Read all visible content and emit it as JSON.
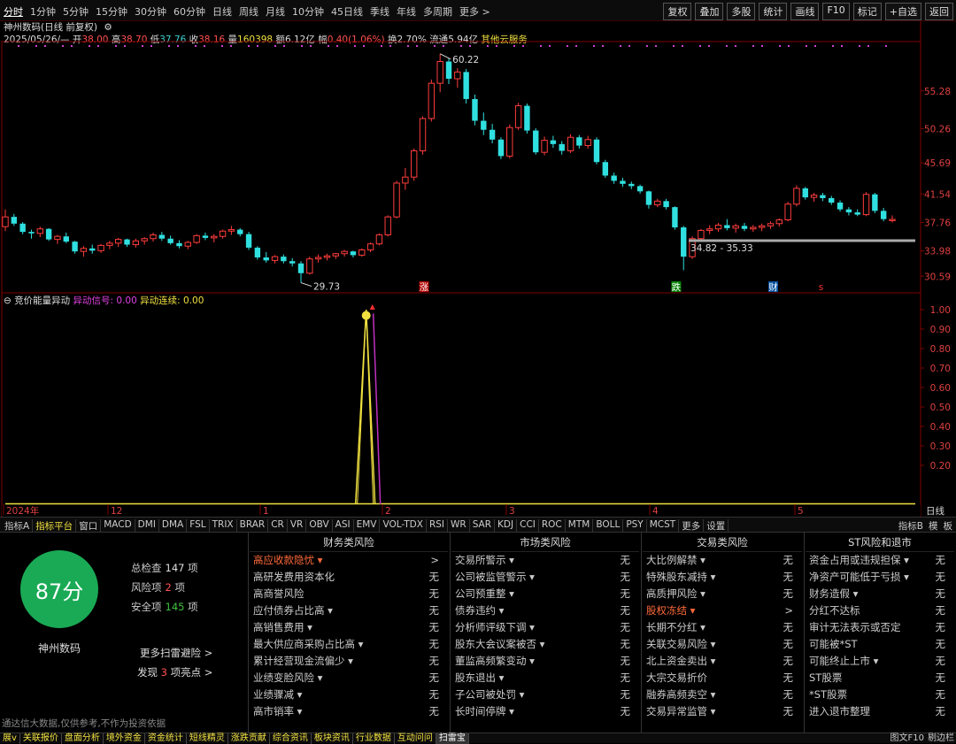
{
  "toolbar": {
    "periods": [
      "分时",
      "1分钟",
      "5分钟",
      "15分钟",
      "30分钟",
      "60分钟",
      "日线",
      "周线",
      "月线",
      "10分钟",
      "45日线",
      "季线",
      "年线",
      "多周期",
      "更多 >"
    ],
    "selected_index": 0,
    "right_buttons": [
      "复权",
      "叠加",
      "多股",
      "统计",
      "画线",
      "F10",
      "标记",
      "+自选",
      "返回"
    ]
  },
  "chart_header": {
    "title": "神州数码(日线 前复权)",
    "date": "2025/05/26/—",
    "open_label": "开",
    "open": "38.00",
    "high_label": "高",
    "high": "38.70",
    "low_label": "低",
    "low": "37.76",
    "close_label": "收",
    "close": "38.16",
    "vol_label": "量",
    "vol": "160398",
    "amount_label": "额",
    "amount": "6.12亿",
    "pct_label": "幅",
    "pct": "0.40(1.06%)",
    "turnover_label": "换",
    "turnover": "2.70%",
    "float_label": "流通",
    "float": "5.94亿",
    "concept": "其他云服务"
  },
  "price_axis": [
    "55.28",
    "50.26",
    "45.69",
    "41.54",
    "37.76",
    "33.98",
    "30.59"
  ],
  "price_annotations": {
    "high_mark": "60.22",
    "low_mark": "29.73",
    "range": "34.82 - 35.33"
  },
  "event_markers": {
    "zhang": "涨",
    "die": "跌",
    "cai": "财",
    "s": "s"
  },
  "indicator": {
    "name": "竞价能量异动",
    "sig1_label": "异动信号",
    "sig1": "0.00",
    "sig2_label": "异动连续",
    "sig2": "0.00",
    "axis": [
      "1.00",
      "0.90",
      "0.80",
      "0.70",
      "0.60",
      "0.50",
      "0.40",
      "0.30",
      "0.20"
    ]
  },
  "date_axis": {
    "labels": [
      "2024年",
      "12",
      "1",
      "2",
      "3",
      "4",
      "5"
    ],
    "right_label": "日线"
  },
  "tabs": {
    "items": [
      "指标A",
      "指标平台",
      "窗口",
      "MACD",
      "DMI",
      "DMA",
      "FSL",
      "TRIX",
      "BRAR",
      "CR",
      "VR",
      "OBV",
      "ASI",
      "EMV",
      "VOL-TDX",
      "RSI",
      "WR",
      "SAR",
      "KDJ",
      "CCI",
      "ROC",
      "MTM",
      "BOLL",
      "PSY",
      "MCST",
      "更多",
      "设置"
    ],
    "right": [
      "指标B",
      "模",
      "板"
    ]
  },
  "panel": {
    "score": "87分",
    "stock_name": "神州数码",
    "total_label": "总检查",
    "total": "147",
    "total_unit": "项",
    "risk_label": "风险项",
    "risk": "2",
    "risk_unit": "项",
    "safe_label": "安全项",
    "safe": "145",
    "safe_unit": "项",
    "more_link": "更多扫雷避险 >",
    "found_pre": "发现",
    "found": "3",
    "found_post": "项亮点 >",
    "columns": [
      {
        "title": "财务类风险",
        "rows": [
          {
            "label": "高应收款隐忧 ▾",
            "value": ">",
            "hl": true
          },
          {
            "label": "高研发费用资本化",
            "value": "无"
          },
          {
            "label": "高商誉风险",
            "value": "无"
          },
          {
            "label": "应付债券占比高 ▾",
            "value": "无"
          },
          {
            "label": "高销售费用 ▾",
            "value": "无"
          },
          {
            "label": "最大供应商采购占比高 ▾",
            "value": "无"
          },
          {
            "label": "累计经营现金流偏少 ▾",
            "value": "无"
          },
          {
            "label": "业绩变脸风险 ▾",
            "value": "无"
          },
          {
            "label": "业绩骤减 ▾",
            "value": "无"
          },
          {
            "label": "高市销率 ▾",
            "value": "无"
          }
        ]
      },
      {
        "title": "市场类风险",
        "rows": [
          {
            "label": "交易所警示 ▾",
            "value": "无"
          },
          {
            "label": "公司被监管警示 ▾",
            "value": "无"
          },
          {
            "label": "公司预重整 ▾",
            "value": "无"
          },
          {
            "label": "债券违约 ▾",
            "value": "无"
          },
          {
            "label": "分析师评级下调 ▾",
            "value": "无"
          },
          {
            "label": "股东大会议案被否 ▾",
            "value": "无"
          },
          {
            "label": "董监高频繁变动 ▾",
            "value": "无"
          },
          {
            "label": "股东退出 ▾",
            "value": "无"
          },
          {
            "label": "子公司被处罚 ▾",
            "value": "无"
          },
          {
            "label": "长时间停牌 ▾",
            "value": "无"
          }
        ]
      },
      {
        "title": "交易类风险",
        "rows": [
          {
            "label": "大比例解禁 ▾",
            "value": "无"
          },
          {
            "label": "特殊股东减持 ▾",
            "value": "无"
          },
          {
            "label": "高质押风险 ▾",
            "value": "无"
          },
          {
            "label": "股权冻结 ▾",
            "value": ">",
            "hl": true
          },
          {
            "label": "长期不分红 ▾",
            "value": "无"
          },
          {
            "label": "关联交易风险 ▾",
            "value": "无"
          },
          {
            "label": "北上资金卖出 ▾",
            "value": "无"
          },
          {
            "label": "大宗交易折价",
            "value": "无"
          },
          {
            "label": "融券高频卖空 ▾",
            "value": "无"
          },
          {
            "label": "交易异常监管 ▾",
            "value": "无"
          }
        ]
      },
      {
        "title": "ST风险和退市",
        "rows": [
          {
            "label": "资金占用或违规担保 ▾",
            "value": "无"
          },
          {
            "label": "净资产可能低于亏损 ▾",
            "value": "无"
          },
          {
            "label": "财务造假 ▾",
            "value": "无"
          },
          {
            "label": "分红不达标",
            "value": "无"
          },
          {
            "label": "审计无法表示或否定",
            "value": "无"
          },
          {
            "label": "可能被*ST",
            "value": "无"
          },
          {
            "label": "可能终止上市 ▾",
            "value": "无"
          },
          {
            "label": "ST股票",
            "value": "无"
          },
          {
            "label": "*ST股票",
            "value": "无"
          },
          {
            "label": "进入退市整理",
            "value": "无"
          }
        ]
      }
    ]
  },
  "disclaimer": "通达信大数据,仅供参考,不作为投资依据",
  "bottom_tabs": {
    "items": [
      "展v",
      "关联报价",
      "盘面分析",
      "境外资金",
      "资金统计",
      "短线精灵",
      "涨跌贡献",
      "综合资讯",
      "板块资讯",
      "行业数据",
      "互动问问",
      "扫雷宝"
    ],
    "active_index": 11,
    "right": [
      "图文F10",
      "剔边栏"
    ]
  },
  "chart_data": {
    "type": "candlestick",
    "title": "神州数码(日线 前复权)",
    "y_ticks": [
      55.28,
      50.26,
      45.69,
      41.54,
      37.76,
      33.98,
      30.59
    ],
    "ohlc": [
      [
        37.2,
        39.5,
        36.6,
        38.5
      ],
      [
        38.5,
        38.9,
        37.3,
        37.6
      ],
      [
        37.6,
        37.8,
        36.2,
        36.5
      ],
      [
        36.5,
        36.8,
        35.6,
        36.3
      ],
      [
        36.3,
        37.2,
        35.8,
        36.9
      ],
      [
        36.9,
        37.0,
        35.3,
        35.5
      ],
      [
        35.5,
        36.1,
        34.9,
        35.9
      ],
      [
        35.9,
        36.4,
        35.0,
        35.2
      ],
      [
        35.2,
        35.3,
        33.6,
        33.9
      ],
      [
        33.9,
        34.6,
        33.2,
        34.3
      ],
      [
        34.3,
        34.8,
        33.6,
        34.0
      ],
      [
        34.0,
        34.9,
        33.7,
        34.7
      ],
      [
        34.7,
        35.3,
        34.2,
        35.0
      ],
      [
        35.0,
        35.7,
        34.5,
        35.5
      ],
      [
        35.5,
        35.6,
        34.5,
        34.8
      ],
      [
        34.8,
        35.6,
        34.4,
        35.3
      ],
      [
        35.3,
        35.8,
        34.8,
        35.6
      ],
      [
        35.6,
        36.4,
        35.2,
        36.1
      ],
      [
        36.1,
        36.5,
        35.3,
        35.6
      ],
      [
        35.6,
        36.0,
        34.8,
        35.0
      ],
      [
        35.0,
        35.4,
        34.3,
        34.6
      ],
      [
        34.6,
        35.3,
        34.2,
        35.1
      ],
      [
        35.1,
        36.2,
        34.9,
        36.0
      ],
      [
        36.0,
        36.4,
        35.4,
        35.7
      ],
      [
        35.7,
        36.2,
        35.1,
        35.9
      ],
      [
        35.9,
        36.8,
        35.6,
        36.6
      ],
      [
        36.6,
        37.3,
        36.1,
        36.8
      ],
      [
        36.8,
        37.0,
        35.9,
        36.2
      ],
      [
        36.2,
        36.5,
        34.1,
        34.4
      ],
      [
        34.4,
        34.6,
        32.8,
        33.1
      ],
      [
        33.1,
        33.8,
        32.4,
        32.7
      ],
      [
        32.7,
        33.4,
        32.3,
        33.2
      ],
      [
        33.2,
        33.5,
        32.3,
        32.6
      ],
      [
        32.6,
        33.0,
        31.9,
        32.3
      ],
      [
        32.3,
        32.6,
        29.73,
        31.0
      ],
      [
        31.0,
        33.2,
        30.8,
        32.9
      ],
      [
        32.9,
        33.5,
        32.4,
        33.1
      ],
      [
        33.1,
        33.6,
        32.7,
        33.3
      ],
      [
        33.3,
        33.7,
        32.9,
        33.6
      ],
      [
        33.6,
        34.1,
        33.2,
        33.9
      ],
      [
        33.9,
        34.0,
        33.1,
        33.4
      ],
      [
        33.4,
        34.3,
        33.2,
        34.1
      ],
      [
        34.1,
        35.1,
        33.8,
        34.9
      ],
      [
        34.9,
        36.3,
        34.7,
        36.1
      ],
      [
        36.1,
        38.7,
        35.9,
        38.5
      ],
      [
        38.5,
        43.3,
        38.3,
        43.0
      ],
      [
        43.0,
        45.0,
        42.1,
        43.8
      ],
      [
        43.8,
        47.6,
        43.3,
        47.3
      ],
      [
        47.3,
        51.9,
        46.8,
        51.6
      ],
      [
        51.6,
        56.8,
        51.2,
        56.3
      ],
      [
        56.3,
        60.22,
        55.1,
        59.2
      ],
      [
        59.2,
        59.6,
        56.2,
        56.9
      ],
      [
        56.9,
        58.3,
        55.7,
        57.8
      ],
      [
        57.8,
        58.2,
        53.6,
        54.2
      ],
      [
        54.2,
        54.8,
        50.7,
        51.3
      ],
      [
        51.3,
        52.4,
        49.4,
        50.1
      ],
      [
        50.1,
        50.9,
        48.3,
        48.8
      ],
      [
        48.8,
        49.1,
        46.2,
        46.6
      ],
      [
        46.6,
        50.8,
        46.3,
        50.4
      ],
      [
        50.4,
        53.7,
        50.1,
        53.3
      ],
      [
        53.3,
        53.6,
        49.6,
        50.0
      ],
      [
        50.0,
        50.3,
        46.8,
        47.1
      ],
      [
        47.1,
        49.2,
        46.7,
        48.7
      ],
      [
        48.7,
        49.3,
        47.7,
        48.2
      ],
      [
        48.2,
        48.6,
        46.8,
        47.3
      ],
      [
        47.3,
        49.5,
        47.0,
        49.1
      ],
      [
        49.1,
        49.4,
        47.6,
        48.0
      ],
      [
        48.0,
        49.3,
        47.6,
        48.8
      ],
      [
        48.8,
        49.1,
        45.5,
        45.8
      ],
      [
        45.8,
        46.1,
        43.7,
        44.0
      ],
      [
        44.0,
        44.4,
        42.9,
        43.3
      ],
      [
        43.3,
        43.7,
        42.5,
        42.9
      ],
      [
        42.9,
        43.2,
        42.2,
        42.6
      ],
      [
        42.6,
        42.8,
        41.6,
        41.9
      ],
      [
        41.9,
        42.0,
        39.6,
        40.1
      ],
      [
        40.1,
        40.9,
        39.8,
        40.6
      ],
      [
        40.6,
        40.9,
        39.5,
        39.8
      ],
      [
        39.8,
        39.9,
        36.8,
        37.1
      ],
      [
        37.1,
        37.3,
        31.4,
        33.2
      ],
      [
        33.2,
        35.9,
        32.9,
        35.6
      ],
      [
        35.6,
        36.9,
        35.2,
        36.7
      ],
      [
        36.7,
        37.4,
        36.2,
        36.9
      ],
      [
        36.9,
        37.7,
        36.5,
        37.4
      ],
      [
        37.4,
        38.2,
        36.7,
        37.0
      ],
      [
        37.0,
        37.6,
        36.4,
        37.3
      ],
      [
        37.3,
        37.7,
        36.6,
        36.9
      ],
      [
        36.9,
        37.4,
        36.5,
        37.1
      ],
      [
        37.1,
        37.6,
        36.6,
        37.3
      ],
      [
        37.3,
        37.9,
        36.9,
        37.6
      ],
      [
        37.6,
        38.3,
        37.2,
        38.1
      ],
      [
        38.1,
        40.5,
        37.9,
        40.2
      ],
      [
        40.2,
        42.7,
        39.9,
        42.3
      ],
      [
        42.3,
        42.5,
        40.8,
        41.1
      ],
      [
        41.1,
        41.7,
        40.5,
        41.4
      ],
      [
        41.4,
        41.7,
        40.6,
        41.0
      ],
      [
        41.0,
        41.3,
        40.1,
        40.4
      ],
      [
        40.4,
        40.7,
        39.2,
        39.5
      ],
      [
        39.5,
        39.8,
        38.7,
        39.1
      ],
      [
        39.1,
        39.5,
        38.6,
        38.8
      ],
      [
        38.8,
        41.8,
        38.6,
        41.5
      ],
      [
        41.5,
        41.7,
        39.0,
        39.3
      ],
      [
        39.3,
        39.7,
        37.9,
        38.2
      ],
      [
        38.0,
        38.7,
        37.76,
        38.16
      ]
    ],
    "indicator_series": {
      "name": "竞价能量异动",
      "spike_index": 47,
      "spike_value": 1.0,
      "baseline": 0.0
    }
  }
}
